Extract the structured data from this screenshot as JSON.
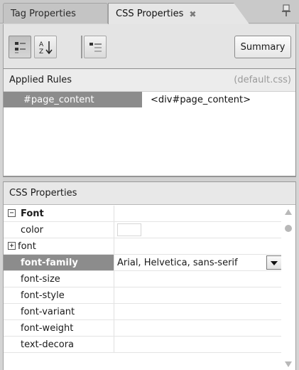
{
  "tabs": [
    {
      "label": "Tag Properties"
    },
    {
      "label": "CSS Properties",
      "close_glyph": "✖"
    }
  ],
  "toolbar": {
    "summary_label": "Summary",
    "icons": [
      "category-view-icon",
      "sort-alphabetical-icon",
      "set-properties-icon"
    ]
  },
  "applied_rules": {
    "header": "Applied Rules",
    "file": "(default.css)",
    "rows": [
      {
        "selector": "#page_content",
        "source": "<div#page_content>"
      }
    ]
  },
  "css_properties": {
    "header": "CSS Properties",
    "group": {
      "label": "Font",
      "expander": "−"
    },
    "rows": [
      {
        "name": "color",
        "value": ""
      },
      {
        "name": "font",
        "value": "",
        "expander": "+"
      },
      {
        "name": "font-family",
        "value": "Arial, Helvetica, sans-serif"
      },
      {
        "name": "font-size",
        "value": ""
      },
      {
        "name": "font-style",
        "value": ""
      },
      {
        "name": "font-variant",
        "value": ""
      },
      {
        "name": "font-weight",
        "value": ""
      },
      {
        "name": "text-decora",
        "value": ""
      }
    ]
  },
  "colors": {
    "selection": "#8c8c8c",
    "panel_bg": "#d4d4d4",
    "header_bg": "#ececec"
  }
}
